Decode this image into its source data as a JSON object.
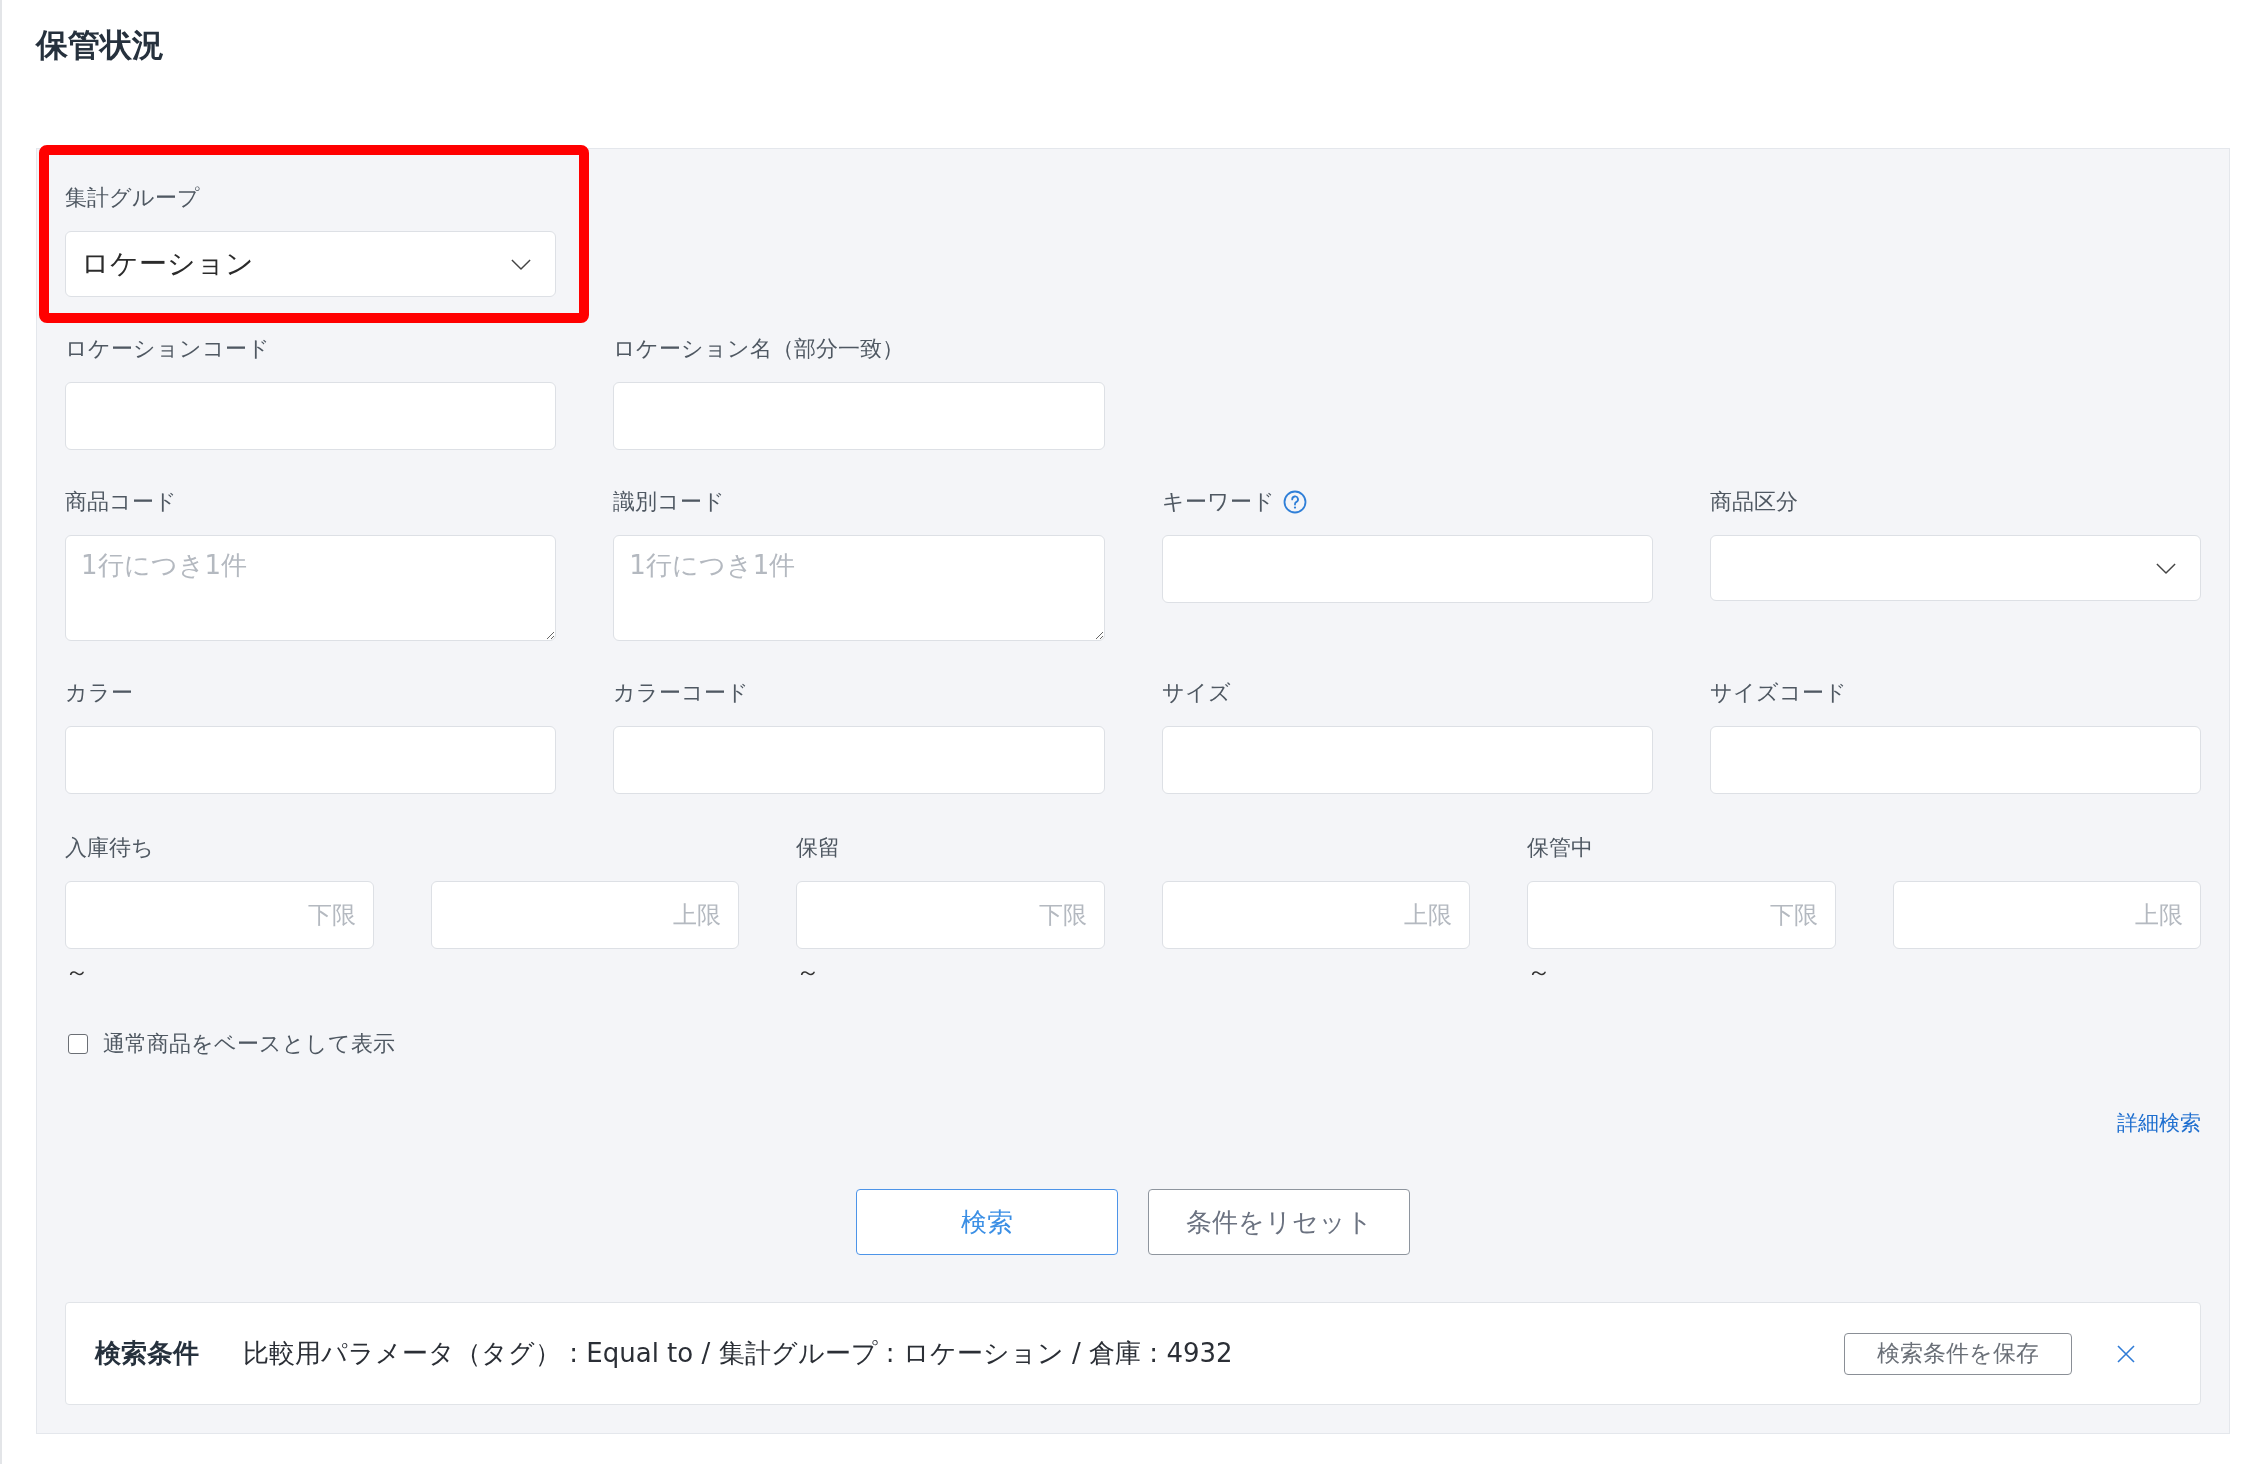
{
  "page": {
    "title": "保管状況"
  },
  "search_panel": {
    "field_rows": [
      [
        {
          "kind": "select",
          "label": "集計グループ",
          "value": "ロケーション",
          "highlighted": true
        }
      ],
      [
        {
          "kind": "input",
          "label": "ロケーションコード"
        },
        {
          "kind": "input",
          "label": "ロケーション名（部分一致）"
        }
      ],
      [
        {
          "kind": "textarea",
          "label": "商品コード",
          "placeholder": "1行につき1件"
        },
        {
          "kind": "textarea",
          "label": "識別コード",
          "placeholder": "1行につき1件"
        },
        {
          "kind": "input",
          "label": "キーワード",
          "help": true
        },
        {
          "kind": "select",
          "label": "商品区分"
        }
      ],
      [
        {
          "kind": "input",
          "label": "カラー"
        },
        {
          "kind": "input",
          "label": "カラーコード"
        },
        {
          "kind": "input",
          "label": "サイズ"
        },
        {
          "kind": "input",
          "label": "サイズコード"
        }
      ]
    ],
    "ranges": [
      {
        "label": "入庫待ち",
        "min": {
          "placeholder": "下限"
        },
        "max": {
          "placeholder": "上限"
        },
        "separator": "～"
      },
      {
        "label": "保留",
        "min": {
          "placeholder": "下限"
        },
        "max": {
          "placeholder": "上限"
        },
        "separator": "～"
      },
      {
        "label": "保管中",
        "min": {
          "placeholder": "下限"
        },
        "max": {
          "placeholder": "上限"
        },
        "separator": "～"
      }
    ],
    "checkbox": {
      "label": "通常商品をベースとして表示",
      "checked": false
    },
    "advanced_search_link": "詳細検索",
    "buttons": [
      {
        "kind": "primary",
        "label": "検索"
      },
      {
        "kind": "secondary",
        "label": "条件をリセット"
      }
    ],
    "conditions_bar": {
      "heading": "検索条件",
      "text": "比較用パラメータ（タグ） : Equal to / 集計グループ : ロケーション / 倉庫 : 4932",
      "save_button": "検索条件を保存"
    }
  }
}
